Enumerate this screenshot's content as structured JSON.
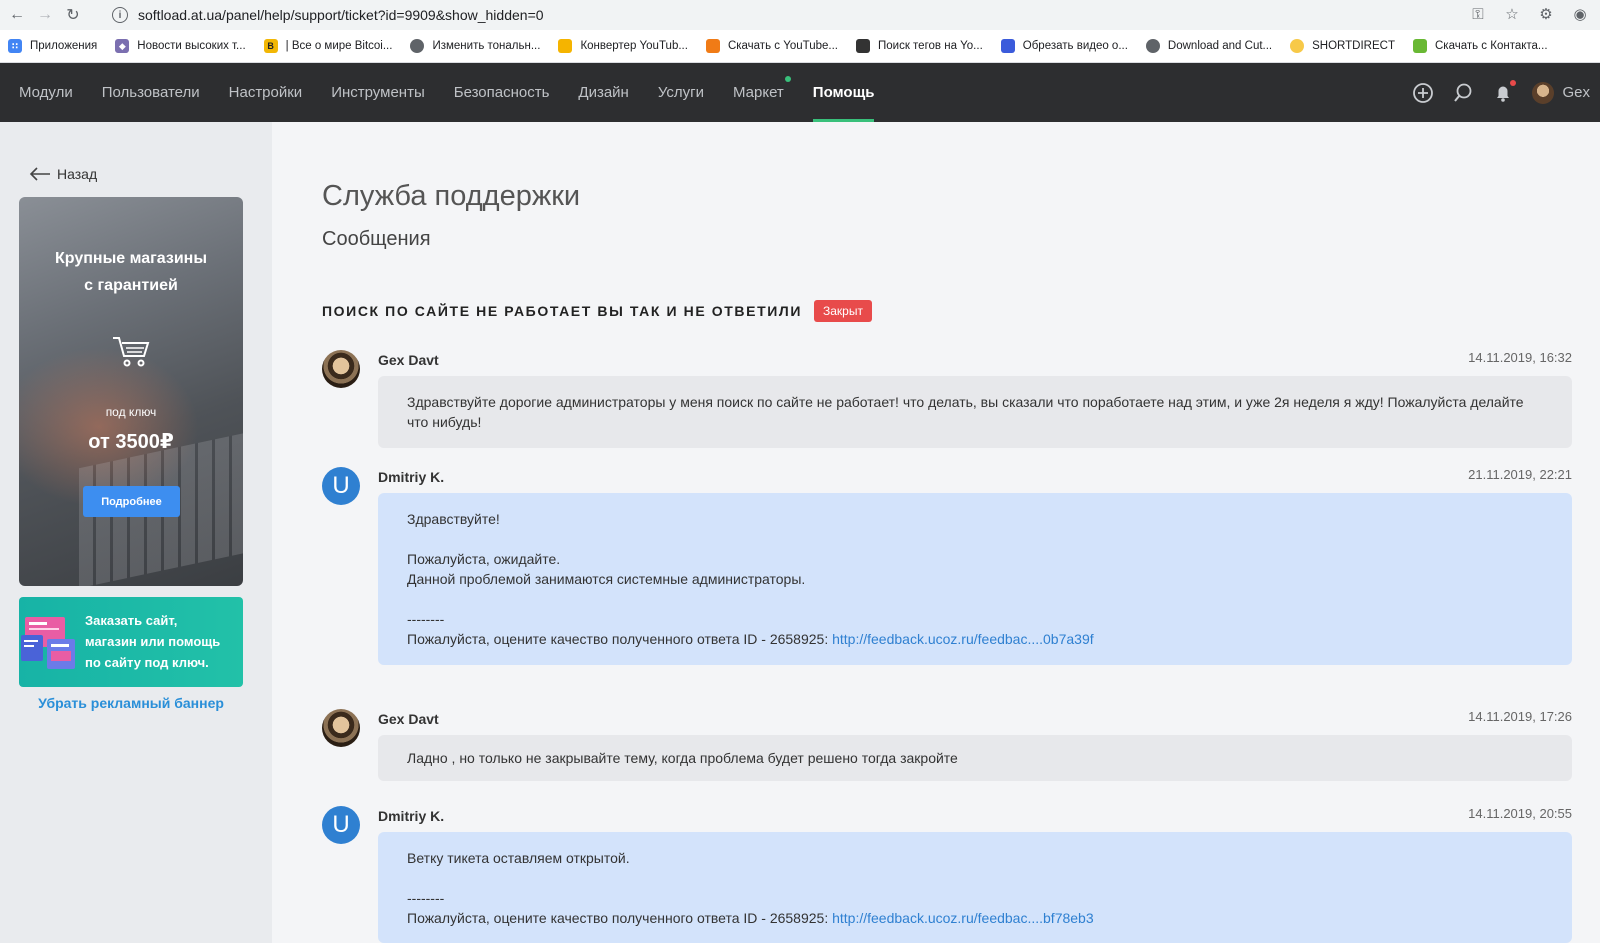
{
  "browser": {
    "url": "softload.at.ua/panel/help/support/ticket?id=9909&show_hidden=0",
    "bookmarks": [
      {
        "label": "Приложения",
        "color": "#4285f4"
      },
      {
        "label": "Новости высоких т...",
        "color": "#7b6fb0"
      },
      {
        "label": "| Все о мире Bitcoi...",
        "color": "#f2b705"
      },
      {
        "label": "Изменить тональн...",
        "color": "#5f6368"
      },
      {
        "label": "Конвертер YouTub...",
        "color": "#f5b400"
      },
      {
        "label": "Скачать с YouTube...",
        "color": "#f07b16"
      },
      {
        "label": "Поиск тегов на Yo...",
        "color": "#333333"
      },
      {
        "label": "Обрезать видео о...",
        "color": "#3b5bdb"
      },
      {
        "label": "Download and Cut...",
        "color": "#5f6368"
      },
      {
        "label": "SHORTDIRECT",
        "color": "#f7c948"
      },
      {
        "label": "Скачать с Контакта...",
        "color": "#69b834"
      }
    ]
  },
  "header": {
    "menu": [
      {
        "label": "Модули",
        "active": false
      },
      {
        "label": "Пользователи",
        "active": false
      },
      {
        "label": "Настройки",
        "active": false
      },
      {
        "label": "Инструменты",
        "active": false
      },
      {
        "label": "Безопасность",
        "active": false
      },
      {
        "label": "Дизайн",
        "active": false
      },
      {
        "label": "Услуги",
        "active": false
      },
      {
        "label": "Маркет",
        "active": false
      },
      {
        "label": "Помощь",
        "active": true
      }
    ],
    "user_name": "Gex",
    "accent_color": "#39c07b"
  },
  "sidebar": {
    "back_label": "Назад",
    "promo": {
      "title_line1": "Крупные магазины",
      "title_line2": "с гарантией",
      "subtitle": "под ключ",
      "price": "от 3500₽",
      "button_label": "Подробнее"
    },
    "banner2": {
      "line1": "Заказать сайт,",
      "line2": "магазин или помощь",
      "line3": "по сайту под ключ."
    },
    "remove_ad_label": "Убрать рекламный баннер"
  },
  "main": {
    "title": "Служба поддержки",
    "subtitle": "Сообщения",
    "ticket_title": "ПОИСК ПО САЙТЕ НЕ РАБОТАЕТ ВЫ ТАК И НЕ ОТВЕТИЛИ",
    "status": "Закрыт",
    "status_color": "#e84b4b"
  },
  "messages": [
    {
      "author": "Gex Davt",
      "time": "14.11.2019, 16:32",
      "text": "Здравствуйте дорогие администраторы у меня поиск по сайте не работает! что делать, вы сказали что поработаете над этим, и уже 2я неделя я жду! Пожалуйста делайте что нибудь!"
    },
    {
      "author": "Dmitriy K.",
      "avatar_letter": "U",
      "time": "21.11.2019, 22:21",
      "line1": "Здравствуйте!",
      "line2": "Пожалуйста, ожидайте.",
      "line3": "Данной проблемой занимаются системные администраторы.",
      "separator": "--------",
      "rate_text": "Пожалуйста, оцените качество полученного ответа ID - 2658925: ",
      "rate_link": "http://feedback.ucoz.ru/feedbac....0b7a39f"
    },
    {
      "author": "Gex Davt",
      "time": "14.11.2019, 17:26",
      "text": "Ладно , но только не закрывайте тему, когда проблема будет решено тогда закройте"
    },
    {
      "author": "Dmitriy K.",
      "avatar_letter": "U",
      "time": "14.11.2019, 20:55",
      "line1": "Ветку тикета оставляем открытой.",
      "separator": "--------",
      "rate_text": "Пожалуйста, оцените качество полученного ответа ID - 2658925: ",
      "rate_link": "http://feedback.ucoz.ru/feedbac....bf78eb3"
    }
  ]
}
